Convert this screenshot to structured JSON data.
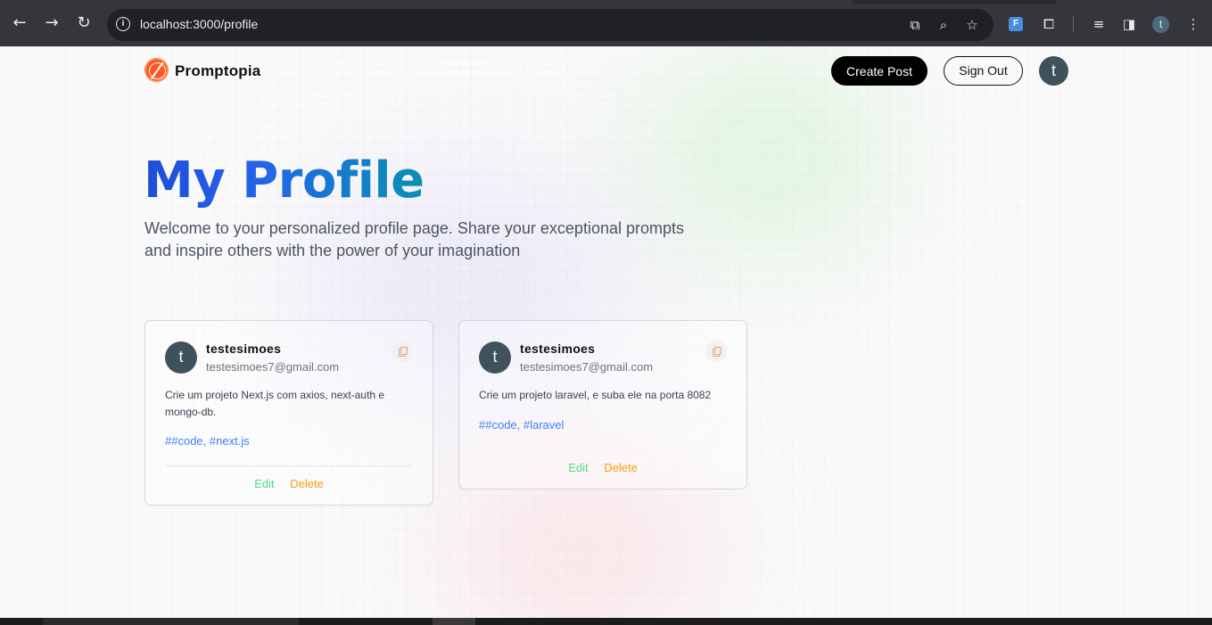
{
  "browser": {
    "url": "localhost:3000/profile",
    "profile_initial": "t",
    "extension_label": "F"
  },
  "nav": {
    "brand": "Promptopia",
    "create_post": "Create Post",
    "sign_out": "Sign Out",
    "avatar_initial": "t"
  },
  "hero": {
    "title": "My Profile",
    "description": "Welcome to your personalized profile page. Share your exceptional prompts and inspire others with the power of your imagination"
  },
  "posts": [
    {
      "avatar_initial": "t",
      "username": "testesimoes",
      "email": "testesimoes7@gmail.com",
      "prompt": "Crie um projeto Next.js com axios, next-auth e mongo-db.",
      "tags": "##code, #next.js",
      "edit": "Edit",
      "delete": "Delete"
    },
    {
      "avatar_initial": "t",
      "username": "testesimoes",
      "email": "testesimoes7@gmail.com",
      "prompt": "Crie um projeto laravel, e suba ele na porta 8082",
      "tags": "##code, #laravel",
      "edit": "Edit",
      "delete": "Delete"
    }
  ],
  "colors": {
    "title_gradient_start": "#1d4ed8",
    "title_gradient_end": "#0891b2",
    "edit": "#4ade80",
    "delete": "#f59e0b",
    "tags": "#3b82f6",
    "logo": "#ff5722"
  }
}
